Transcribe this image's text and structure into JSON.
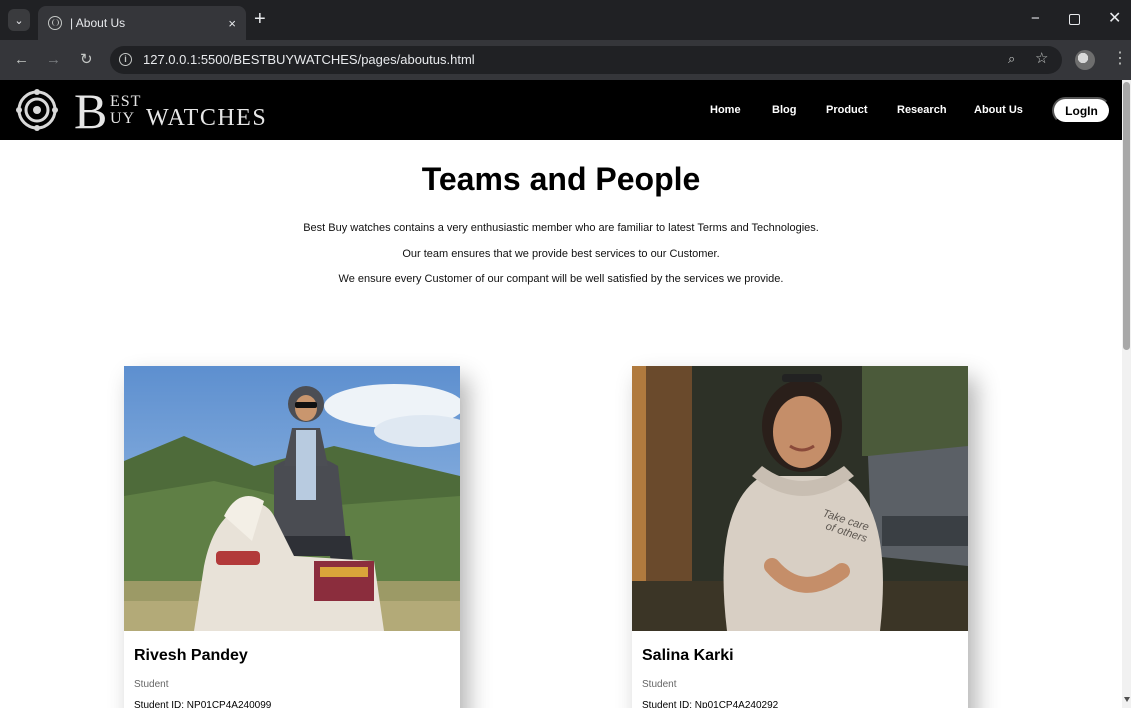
{
  "browser": {
    "tab_title": "| About Us",
    "tab_close": "×",
    "new_tab": "+",
    "url": "127.0.0.1:5500/BESTBUYWATCHES/pages/aboutus.html",
    "win_min": "−",
    "win_close": "✕",
    "icons": [
      "menu-icon",
      "globe-icon",
      "back-icon",
      "forward-icon",
      "reload-icon",
      "info-icon",
      "zoom-icon",
      "star-icon",
      "profile-icon",
      "kebab-icon"
    ]
  },
  "site": {
    "logo": {
      "b": "B",
      "est": "EST",
      "uy": "UY",
      "watches": "WATCHES"
    },
    "nav": {
      "home": "Home",
      "blog": "Blog",
      "product": "Product",
      "research": "Research",
      "about": "About Us",
      "login": "LogIn"
    }
  },
  "page": {
    "title": "Teams and People",
    "intro": [
      "Best Buy watches contains a very enthusiastic member who are familiar to latest Terms and Technologies.",
      "Our team ensures that we provide best services to our Customer.",
      "We ensure every Customer of our compant will be well satisfied by the services we provide."
    ]
  },
  "team": [
    {
      "name": "Rivesh Pandey",
      "role": "Student",
      "id": "Student ID: NP01CP4A240099"
    },
    {
      "name": "Salina Karki",
      "role": "Student",
      "id": "Student ID: Np01CP4A240292"
    }
  ],
  "colors": {
    "chrome_dark": "#202124",
    "chrome_mid": "#35363a",
    "nav_bg": "#000000",
    "text": "#000000",
    "muted": "#666666"
  }
}
